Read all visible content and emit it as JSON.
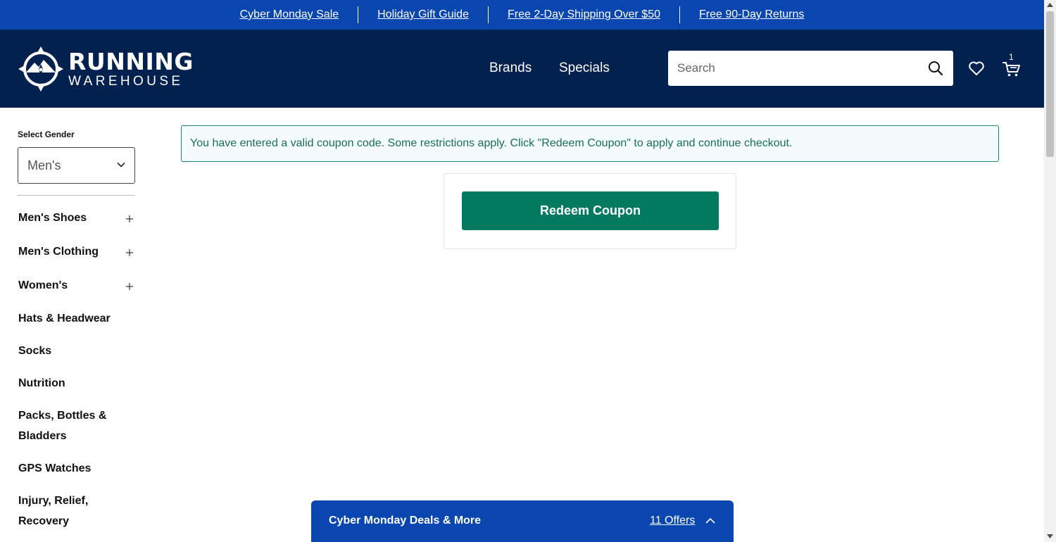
{
  "promo_bar": {
    "links": [
      "Cyber Monday Sale",
      "Holiday Gift Guide",
      "Free 2-Day Shipping Over $50",
      "Free 90-Day Returns"
    ]
  },
  "header": {
    "logo_line1": "RUNNING",
    "logo_line2": "WAREHOUSE",
    "nav": {
      "brands": "Brands",
      "specials": "Specials"
    },
    "search_placeholder": "Search",
    "cart_count": "1",
    "icons": [
      "compass-logo-icon",
      "search-icon",
      "heart-icon",
      "cart-icon"
    ]
  },
  "sidebar": {
    "gender_label": "Select Gender",
    "gender_value": "Men's",
    "categories": [
      {
        "label": "Men's Shoes",
        "expandable": true
      },
      {
        "label": "Men's Clothing",
        "expandable": true
      },
      {
        "label": "Women's",
        "expandable": true
      },
      {
        "label": "Hats & Headwear",
        "expandable": false
      },
      {
        "label": "Socks",
        "expandable": false
      },
      {
        "label": "Nutrition",
        "expandable": false
      },
      {
        "label": "Packs, Bottles & Bladders",
        "expandable": false
      },
      {
        "label": "GPS Watches",
        "expandable": false
      },
      {
        "label": "Injury, Relief, Recovery",
        "expandable": false
      }
    ]
  },
  "main": {
    "alert_text": "You have entered a valid coupon code. Some restrictions apply. Click \"Redeem Coupon\" to apply and continue checkout.",
    "redeem_label": "Redeem Coupon"
  },
  "deals_drawer": {
    "title": "Cyber Monday Deals & More",
    "offers_label": "11 Offers"
  },
  "colors": {
    "promo_bar": "#0a46b0",
    "header": "#02214f",
    "redeem_button": "#037a5f",
    "alert_border": "#1e8a72",
    "alert_text": "#1c6e5c"
  }
}
